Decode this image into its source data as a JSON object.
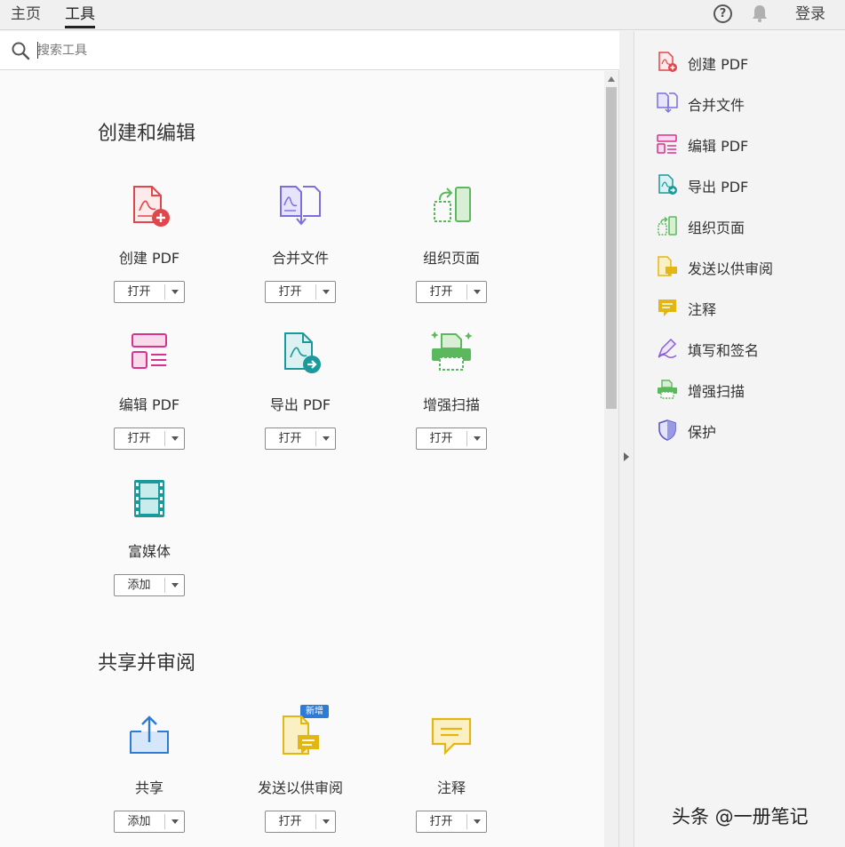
{
  "top_nav": {
    "tabs": [
      {
        "label": "主页"
      },
      {
        "label": "工具"
      }
    ],
    "help": "?",
    "login": "登录"
  },
  "search": {
    "placeholder": "搜索工具"
  },
  "sections": [
    {
      "title": "创建和编辑",
      "tools": [
        {
          "label": "创建 PDF",
          "button": "打开",
          "icon": "create-pdf-icon"
        },
        {
          "label": "合并文件",
          "button": "打开",
          "icon": "combine-files-icon"
        },
        {
          "label": "组织页面",
          "button": "打开",
          "icon": "organize-pages-icon"
        },
        {
          "label": "编辑 PDF",
          "button": "打开",
          "icon": "edit-pdf-icon"
        },
        {
          "label": "导出 PDF",
          "button": "打开",
          "icon": "export-pdf-icon"
        },
        {
          "label": "增强扫描",
          "button": "打开",
          "icon": "enhance-scan-icon"
        },
        {
          "label": "富媒体",
          "button": "添加",
          "icon": "rich-media-icon"
        }
      ]
    },
    {
      "title": "共享并审阅",
      "tools": [
        {
          "label": "共享",
          "button": "添加",
          "icon": "share-icon"
        },
        {
          "label": "发送以供审阅",
          "button": "打开",
          "icon": "send-review-icon",
          "badge": "新增"
        },
        {
          "label": "注释",
          "button": "打开",
          "icon": "comment-icon"
        }
      ]
    }
  ],
  "right_panel": {
    "items": [
      {
        "label": "创建 PDF"
      },
      {
        "label": "合并文件"
      },
      {
        "label": "编辑 PDF"
      },
      {
        "label": "导出 PDF"
      },
      {
        "label": "组织页面"
      },
      {
        "label": "发送以供审阅"
      },
      {
        "label": "注释"
      },
      {
        "label": "填写和签名"
      },
      {
        "label": "增强扫描"
      },
      {
        "label": "保护"
      }
    ]
  },
  "watermark": "头条 @一册笔记",
  "colors": {
    "red": "#e0474c",
    "purple": "#7a6fe0",
    "green": "#5cb85c",
    "pink": "#d6338f",
    "teal": "#1a9a9a",
    "yellow": "#e2b714",
    "blue": "#2d7bd6"
  }
}
